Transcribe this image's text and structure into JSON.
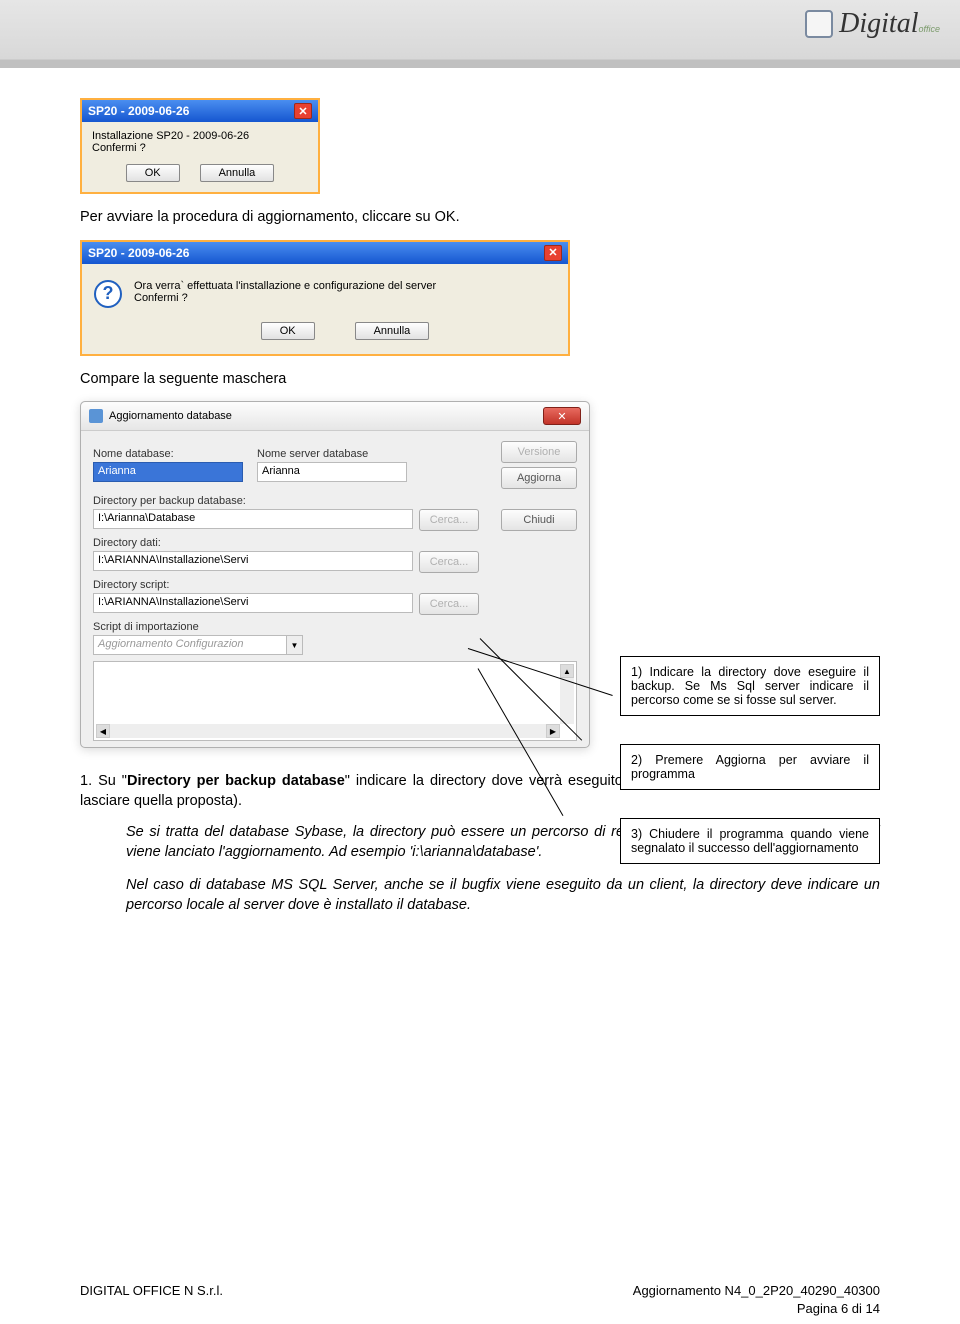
{
  "header": {
    "logo_text": "Digital",
    "logo_sub": "office"
  },
  "dialog1": {
    "title": "SP20 - 2009-06-26",
    "line1": "Installazione SP20 - 2009-06-26",
    "line2": "Confermi ?",
    "ok": "OK",
    "cancel": "Annulla"
  },
  "para1": "Per avviare la procedura di aggiornamento, cliccare su OK.",
  "dialog2": {
    "title": "SP20 - 2009-06-26",
    "msg": "Ora verra` effettuata l'installazione e configurazione del server",
    "line2": "Confermi ?",
    "ok": "OK",
    "cancel": "Annulla"
  },
  "para2": "Compare la seguente maschera",
  "dbwin": {
    "title": "Aggiornamento database",
    "labels": {
      "nome_db": "Nome database:",
      "nome_server": "Nome server database",
      "dir_backup": "Directory per backup database:",
      "dir_dati": "Directory dati:",
      "dir_script": "Directory script:",
      "script_imp": "Script di importazione"
    },
    "values": {
      "nome_db": "Arianna",
      "nome_server": "Arianna",
      "dir_backup": "I:\\Arianna\\Database",
      "dir_dati": "I:\\ARIANNA\\Installazione\\Servi",
      "dir_script": "I:\\ARIANNA\\Installazione\\Servi",
      "script_imp": "Aggiornamento Configurazion"
    },
    "buttons": {
      "versione": "Versione",
      "aggiorna": "Aggiorna",
      "chiudi": "Chiudi",
      "cerca": "Cerca..."
    }
  },
  "callouts": {
    "c1": "1) Indicare la directory dove eseguire il backup. Se Ms Sql server indicare il percorso come se si fosse sul server.",
    "c2": "2) Premere Aggiorna per avviare il programma",
    "c3": "3) Chiudere il programma quando viene segnalato il successo dell'aggiornamento"
  },
  "body": {
    "p1_prefix": "1. Su \"",
    "p1_bold": "Directory per backup database",
    "p1_suffix": "\" indicare la directory dove verrà eseguito il backup del database (si consiglia di lasciare quella proposta).",
    "p2": "Se si tratta del database Sybase, la directory può essere un percorso di rete o un percorso locale al client da cui viene lanciato l'aggiornamento. Ad esempio 'i:\\arianna\\database'.",
    "p3": "Nel caso di database MS SQL Server, anche se il bugfix viene eseguito da un client, la directory deve indicare un percorso locale al server dove è installato il database."
  },
  "footer": {
    "left": "DIGITAL OFFICE N S.r.l.",
    "right": "Aggiornamento N4_0_2P20_40290_40300",
    "page": "Pagina 6 di 14"
  }
}
